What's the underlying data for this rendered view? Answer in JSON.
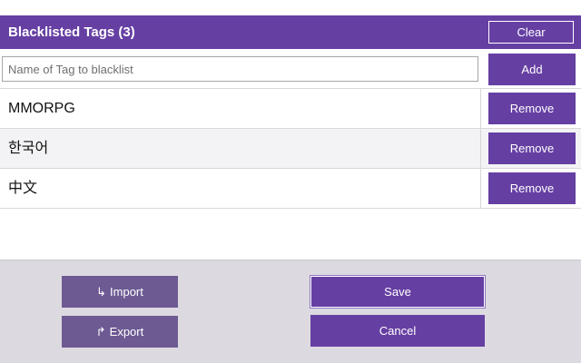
{
  "header": {
    "title": "Blacklisted Tags (3)",
    "clear_label": "Clear"
  },
  "input": {
    "placeholder": "Name of Tag to blacklist",
    "value": "",
    "add_label": "Add"
  },
  "tags": [
    {
      "label": "MMORPG",
      "remove_label": "Remove"
    },
    {
      "label": "한국어",
      "remove_label": "Remove"
    },
    {
      "label": "中文",
      "remove_label": "Remove"
    }
  ],
  "footer": {
    "import_icon": "↳",
    "import_label": "Import",
    "export_icon": "↱",
    "export_label": "Export",
    "save_label": "Save",
    "cancel_label": "Cancel"
  },
  "colors": {
    "accent": "#663fa3",
    "secondary": "#6e5a93",
    "footer_bg": "#dcdae0"
  }
}
